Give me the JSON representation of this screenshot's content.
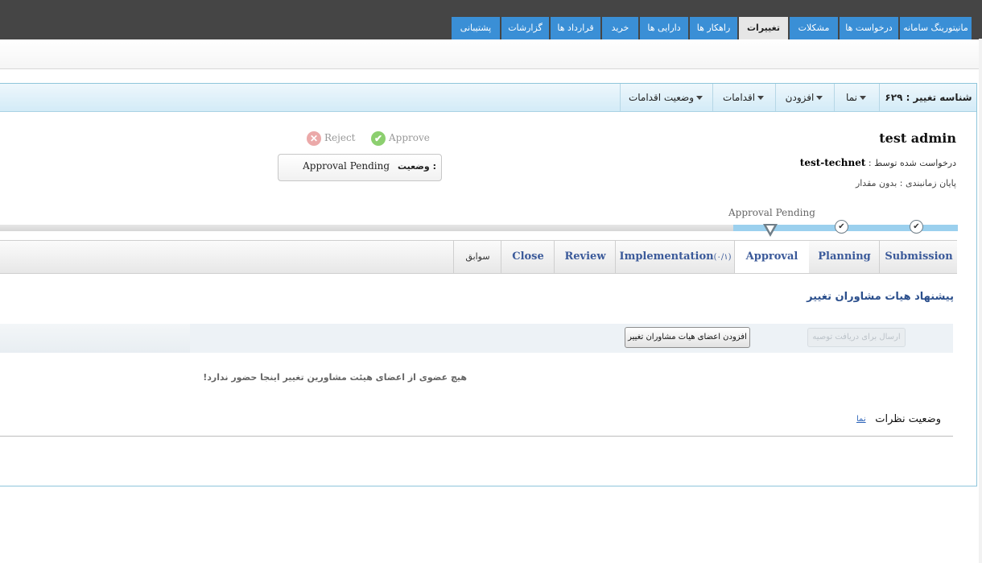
{
  "nav": {
    "items": [
      {
        "label": "مانیتورینگ سامانه",
        "active": false
      },
      {
        "label": "درخواست ها",
        "active": false
      },
      {
        "label": "مشکلات",
        "active": false
      },
      {
        "label": "تغییرات",
        "active": true
      },
      {
        "label": "راهکار ها",
        "active": false
      },
      {
        "label": "دارایی ها",
        "active": false
      },
      {
        "label": "خرید",
        "active": false
      },
      {
        "label": "قرارداد ها",
        "active": false
      },
      {
        "label": "گزارشات",
        "active": false
      },
      {
        "label": "پشتیبانی",
        "active": false
      }
    ]
  },
  "toolbar": {
    "change_id": "شناسه تغییر : ۶۲۹",
    "view": "نما",
    "add": "افزودن",
    "actions": "اقدامات",
    "action_status": "وضعیت اقدامات"
  },
  "change": {
    "title": "test admin",
    "requested_by_label": "درخواست شده توسط :",
    "requested_by": "test-technet",
    "schedule_end": "پایان زمانبندی : بدون مقدار"
  },
  "approval": {
    "approve_label": "Approve",
    "reject_label": "Reject",
    "status_label": "وضعیت :",
    "status_value": "Approval Pending"
  },
  "progress": {
    "current_stage_label": "Approval Pending",
    "accent_color": "#9bd0ee"
  },
  "tabs": [
    {
      "label": "Submission"
    },
    {
      "label": "Planning"
    },
    {
      "label": "Approval"
    },
    {
      "label": "Implementation",
      "count": "(۰/۱)"
    },
    {
      "label": "Review"
    },
    {
      "label": "Close"
    },
    {
      "label": "سوابق"
    }
  ],
  "cab": {
    "title": "پیشنهاد هیات مشاوران تغییر",
    "send_button": "ارسال برای دریافت توصیه",
    "add_members_button": "افزودن اعضای هیات مشاوران تغییر",
    "no_members": "هیچ عضوی از اعضای هیئت مشاورین تغییر اینجا حضور ندارد!"
  },
  "votes": {
    "title": "وضعیت نظرات",
    "view_link": "نما"
  },
  "colors": {
    "nav_blue": "#3a8fd6",
    "topbar": "#454545",
    "tab_text": "#3b5a9a"
  }
}
